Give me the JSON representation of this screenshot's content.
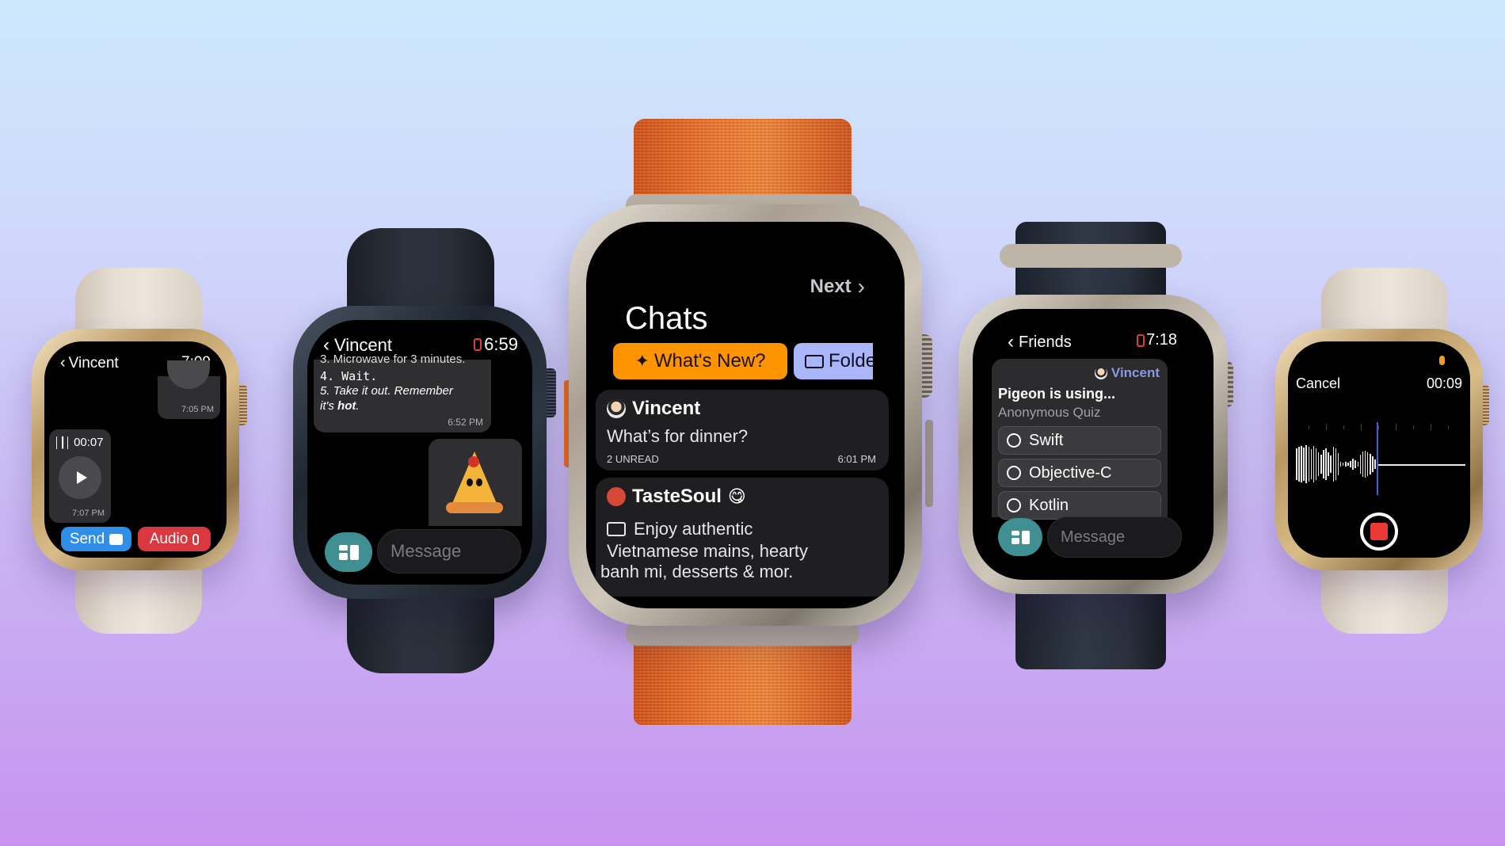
{
  "colors": {
    "background_top": "#cde8fd",
    "background_bottom": "#c893ef",
    "accent_orange": "#fe9400",
    "folder_chip": "#a9b6f9",
    "send_blue": "#2e8ee8",
    "audio_red": "#d8383e",
    "teal_button": "#3f8f93",
    "record_red": "#ea3a33",
    "sender_link": "#8c97e6"
  },
  "watches": [
    {
      "id": "watch-1-voice-chat",
      "header": {
        "back_label": "Vincent",
        "time": "7:09"
      },
      "messages": [
        {
          "type": "audio",
          "side": "right",
          "timestamp": "7:05 PM"
        },
        {
          "type": "audio",
          "side": "left",
          "duration": "00:07",
          "timestamp": "7:07 PM"
        }
      ],
      "actions": {
        "send_label": "Send",
        "audio_label": "Audio"
      }
    },
    {
      "id": "watch-2-recipe-chat",
      "header": {
        "back_label": "Vincent",
        "time": "6:59",
        "status_icon": "phone-disconnected-icon"
      },
      "message": {
        "line_cut": "3. Microwave for 3 minutes.",
        "line_4": "4. Wait.",
        "line_5_prefix": "5. Take it out. Remember",
        "line_5_suffix_a": "it's ",
        "line_5_bold": "hot",
        "line_5_end": ".",
        "timestamp": "6:52 PM"
      },
      "sticker": "pizza-sticker",
      "input": {
        "placeholder": "Message"
      }
    },
    {
      "id": "watch-3-chat-list",
      "header": {
        "next_label": "Next",
        "title": "Chats"
      },
      "chips": [
        {
          "label": "What's New?",
          "icon": "sparkles-icon"
        },
        {
          "label": "Folders",
          "icon": "folder-icon"
        }
      ],
      "chats": [
        {
          "name": "Vincent",
          "preview": "What’s for dinner?",
          "unread": "2 UNREAD",
          "time": "6:01 PM"
        },
        {
          "name": "TasteSoul",
          "emoji": "😋",
          "preview_line_1": "Enjoy authentic",
          "preview_line_2": "Vietnamese mains, hearty",
          "preview_line_3": "banh mi, desserts & mor."
        }
      ]
    },
    {
      "id": "watch-4-quiz",
      "header": {
        "back_label": "Friends",
        "time": "7:18",
        "status_icon": "phone-disconnected-icon"
      },
      "quiz": {
        "sender": "Vincent",
        "question": "Pigeon is using...",
        "kind": "Anonymous Quiz",
        "options": [
          "Swift",
          "Objective-C",
          "Kotlin"
        ]
      },
      "input": {
        "placeholder": "Message"
      }
    },
    {
      "id": "watch-5-recording",
      "header": {
        "cancel_label": "Cancel",
        "elapsed": "00:09"
      },
      "recording": {
        "state": "recording",
        "stop_icon": "stop-icon"
      }
    }
  ]
}
